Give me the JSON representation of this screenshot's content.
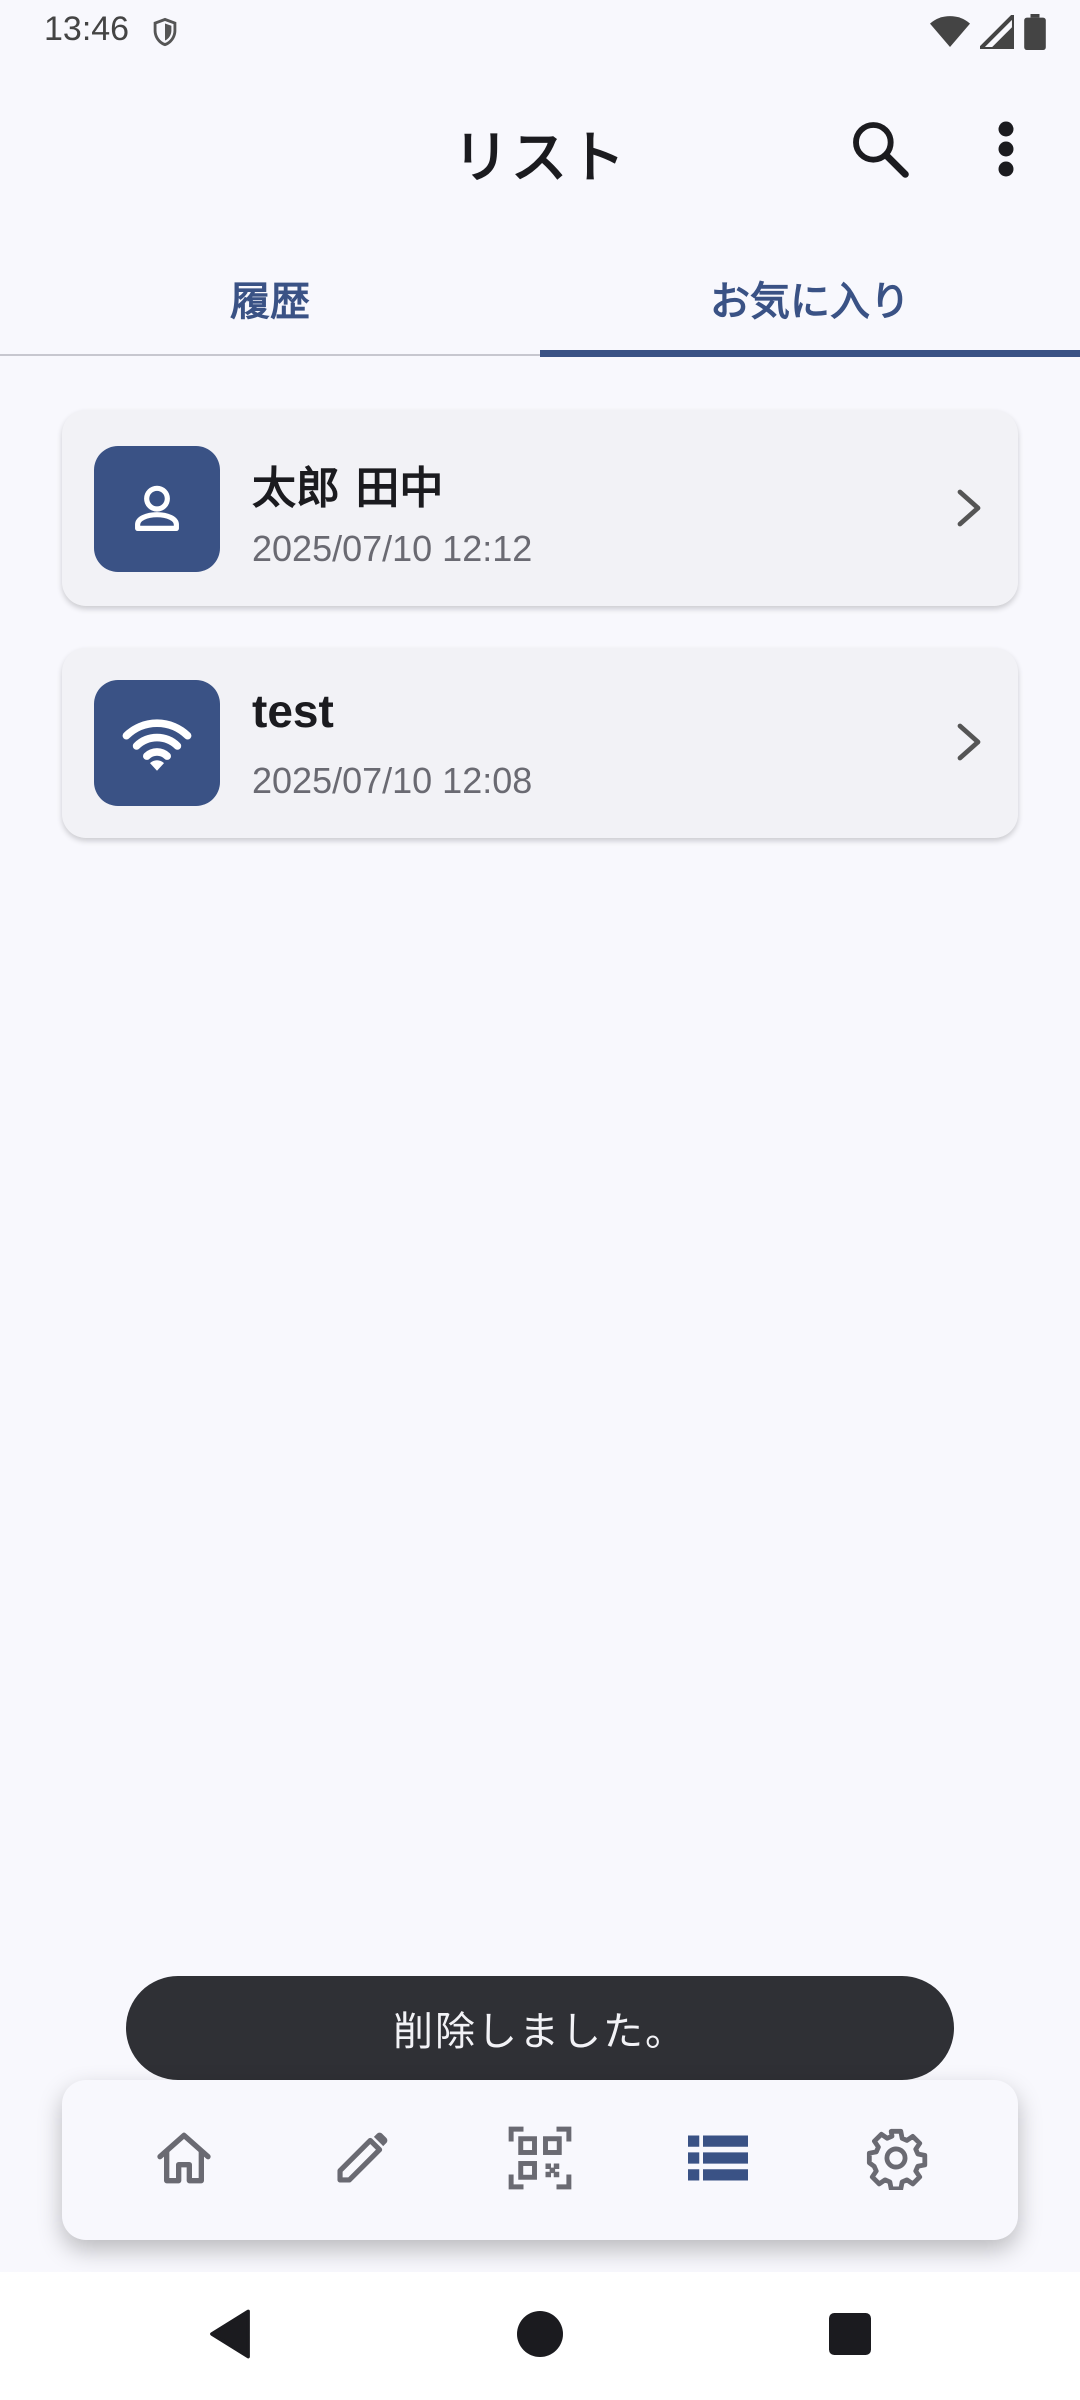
{
  "status_bar": {
    "time": "13:46",
    "icons": [
      "shield-icon",
      "wifi-icon",
      "signal-icon",
      "battery-icon"
    ]
  },
  "app_bar": {
    "title": "リスト",
    "actions": [
      "search-icon",
      "more-vert-icon"
    ]
  },
  "tabs": [
    {
      "label": "履歴",
      "selected": false
    },
    {
      "label": "お気に入り",
      "selected": true
    }
  ],
  "list": {
    "items": [
      {
        "icon": "person-icon",
        "title": "太郎 田中",
        "date": "2025/07/10 12:12"
      },
      {
        "icon": "wifi-icon",
        "title": "test",
        "date": "2025/07/10 12:08"
      }
    ]
  },
  "snackbar": {
    "message": "削除しました。"
  },
  "bottom_nav": {
    "items": [
      {
        "icon": "home-icon",
        "selected": false
      },
      {
        "icon": "edit-icon",
        "selected": false
      },
      {
        "icon": "qr-code-icon",
        "selected": false
      },
      {
        "icon": "list-icon",
        "selected": true
      },
      {
        "icon": "settings-icon",
        "selected": false
      }
    ]
  },
  "colors": {
    "accent": "#3a5285",
    "background": "#f8f8fd",
    "card": "#f2f2f6",
    "snackbar": "#2f3035",
    "inactive_icon": "#6a6a72"
  }
}
